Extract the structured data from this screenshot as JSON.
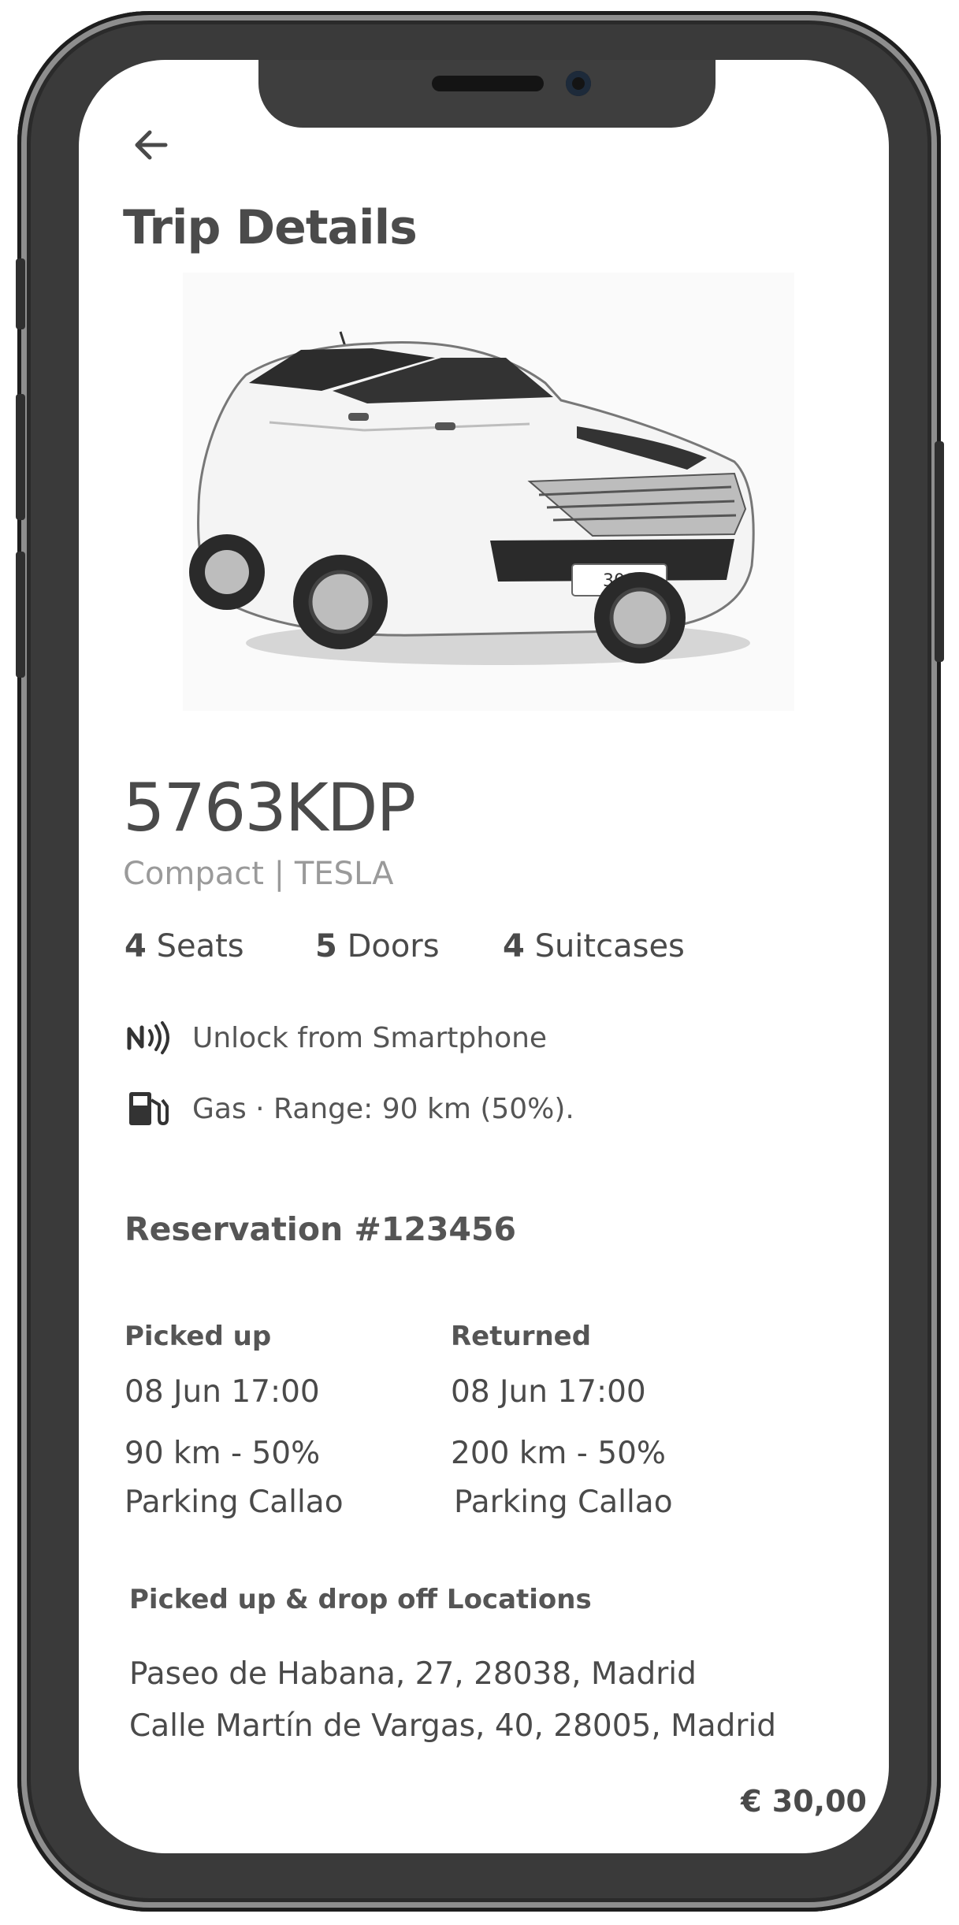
{
  "header": {
    "title": "Trip Details"
  },
  "car": {
    "plate": "5763KDP",
    "subtitle": "Compact | TESLA",
    "image_plate_text": "308",
    "specs": {
      "seats_count": "4",
      "seats_label": "Seats",
      "doors_count": "5",
      "doors_label": "Doors",
      "suitcases_count": "4",
      "suitcases_label": "Suitcases"
    },
    "features": [
      {
        "icon": "nfc-icon",
        "text": "Unlock from Smartphone"
      },
      {
        "icon": "fuel-pump-icon",
        "text": "Gas · Range: 90 km (50%)."
      }
    ]
  },
  "reservation": {
    "label": "Reservation #123456",
    "picked_up": {
      "heading": "Picked up",
      "datetime": "08 Jun 17:00",
      "odometer": "90 km - 50%",
      "location": "Parking Callao"
    },
    "returned": {
      "heading": "Returned",
      "datetime": "08 Jun 17:00",
      "odometer": "200 km - 50%",
      "location": "Parking Callao"
    }
  },
  "locations": {
    "heading": "Picked up & drop off Locations",
    "addresses": [
      "Paseo de Habana, 27, 28038, Madrid",
      "Calle Martín de Vargas, 40, 28005, Madrid"
    ]
  },
  "price": "€ 30,00"
}
